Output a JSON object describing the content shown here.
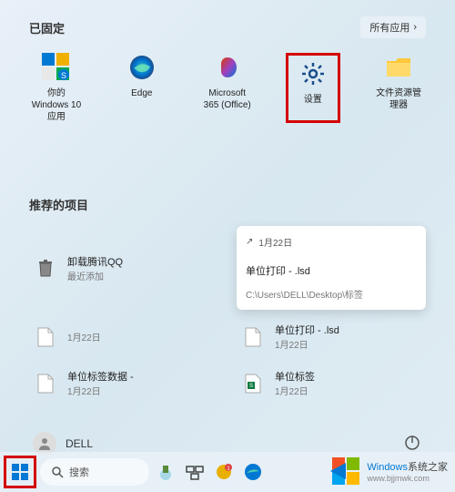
{
  "pinned": {
    "title": "已固定",
    "allApps": "所有应用",
    "items": [
      {
        "label": "你的 Windows 10 应用"
      },
      {
        "label": "Edge"
      },
      {
        "label": "Microsoft 365 (Office)"
      },
      {
        "label": "设置"
      },
      {
        "label": "文件资源管理器"
      }
    ]
  },
  "recommended": {
    "title": "推荐的项目",
    "popup": {
      "date": "1月22日",
      "title": "单位打印 - .lsd",
      "path": "C:\\Users\\DELL\\Desktop\\标签"
    },
    "items": [
      {
        "title": "卸载腾讯QQ",
        "sub": "最近添加"
      },
      {
        "title": "",
        "sub": "1月22日"
      },
      {
        "title": "单位打印 - .lsd",
        "sub": "1月22日"
      },
      {
        "title": "单位标签数据 -",
        "sub": "1月22日"
      },
      {
        "title": "单位标签",
        "sub": "1月22日"
      }
    ]
  },
  "user": {
    "name": "DELL"
  },
  "taskbar": {
    "searchPlaceholder": "搜索"
  },
  "watermark": {
    "brand": "Windows",
    "subtitle": "系统之家",
    "url": "www.bjjmwk.com"
  },
  "colors": {
    "highlight": "#d40000",
    "accent": "#0078d4"
  }
}
